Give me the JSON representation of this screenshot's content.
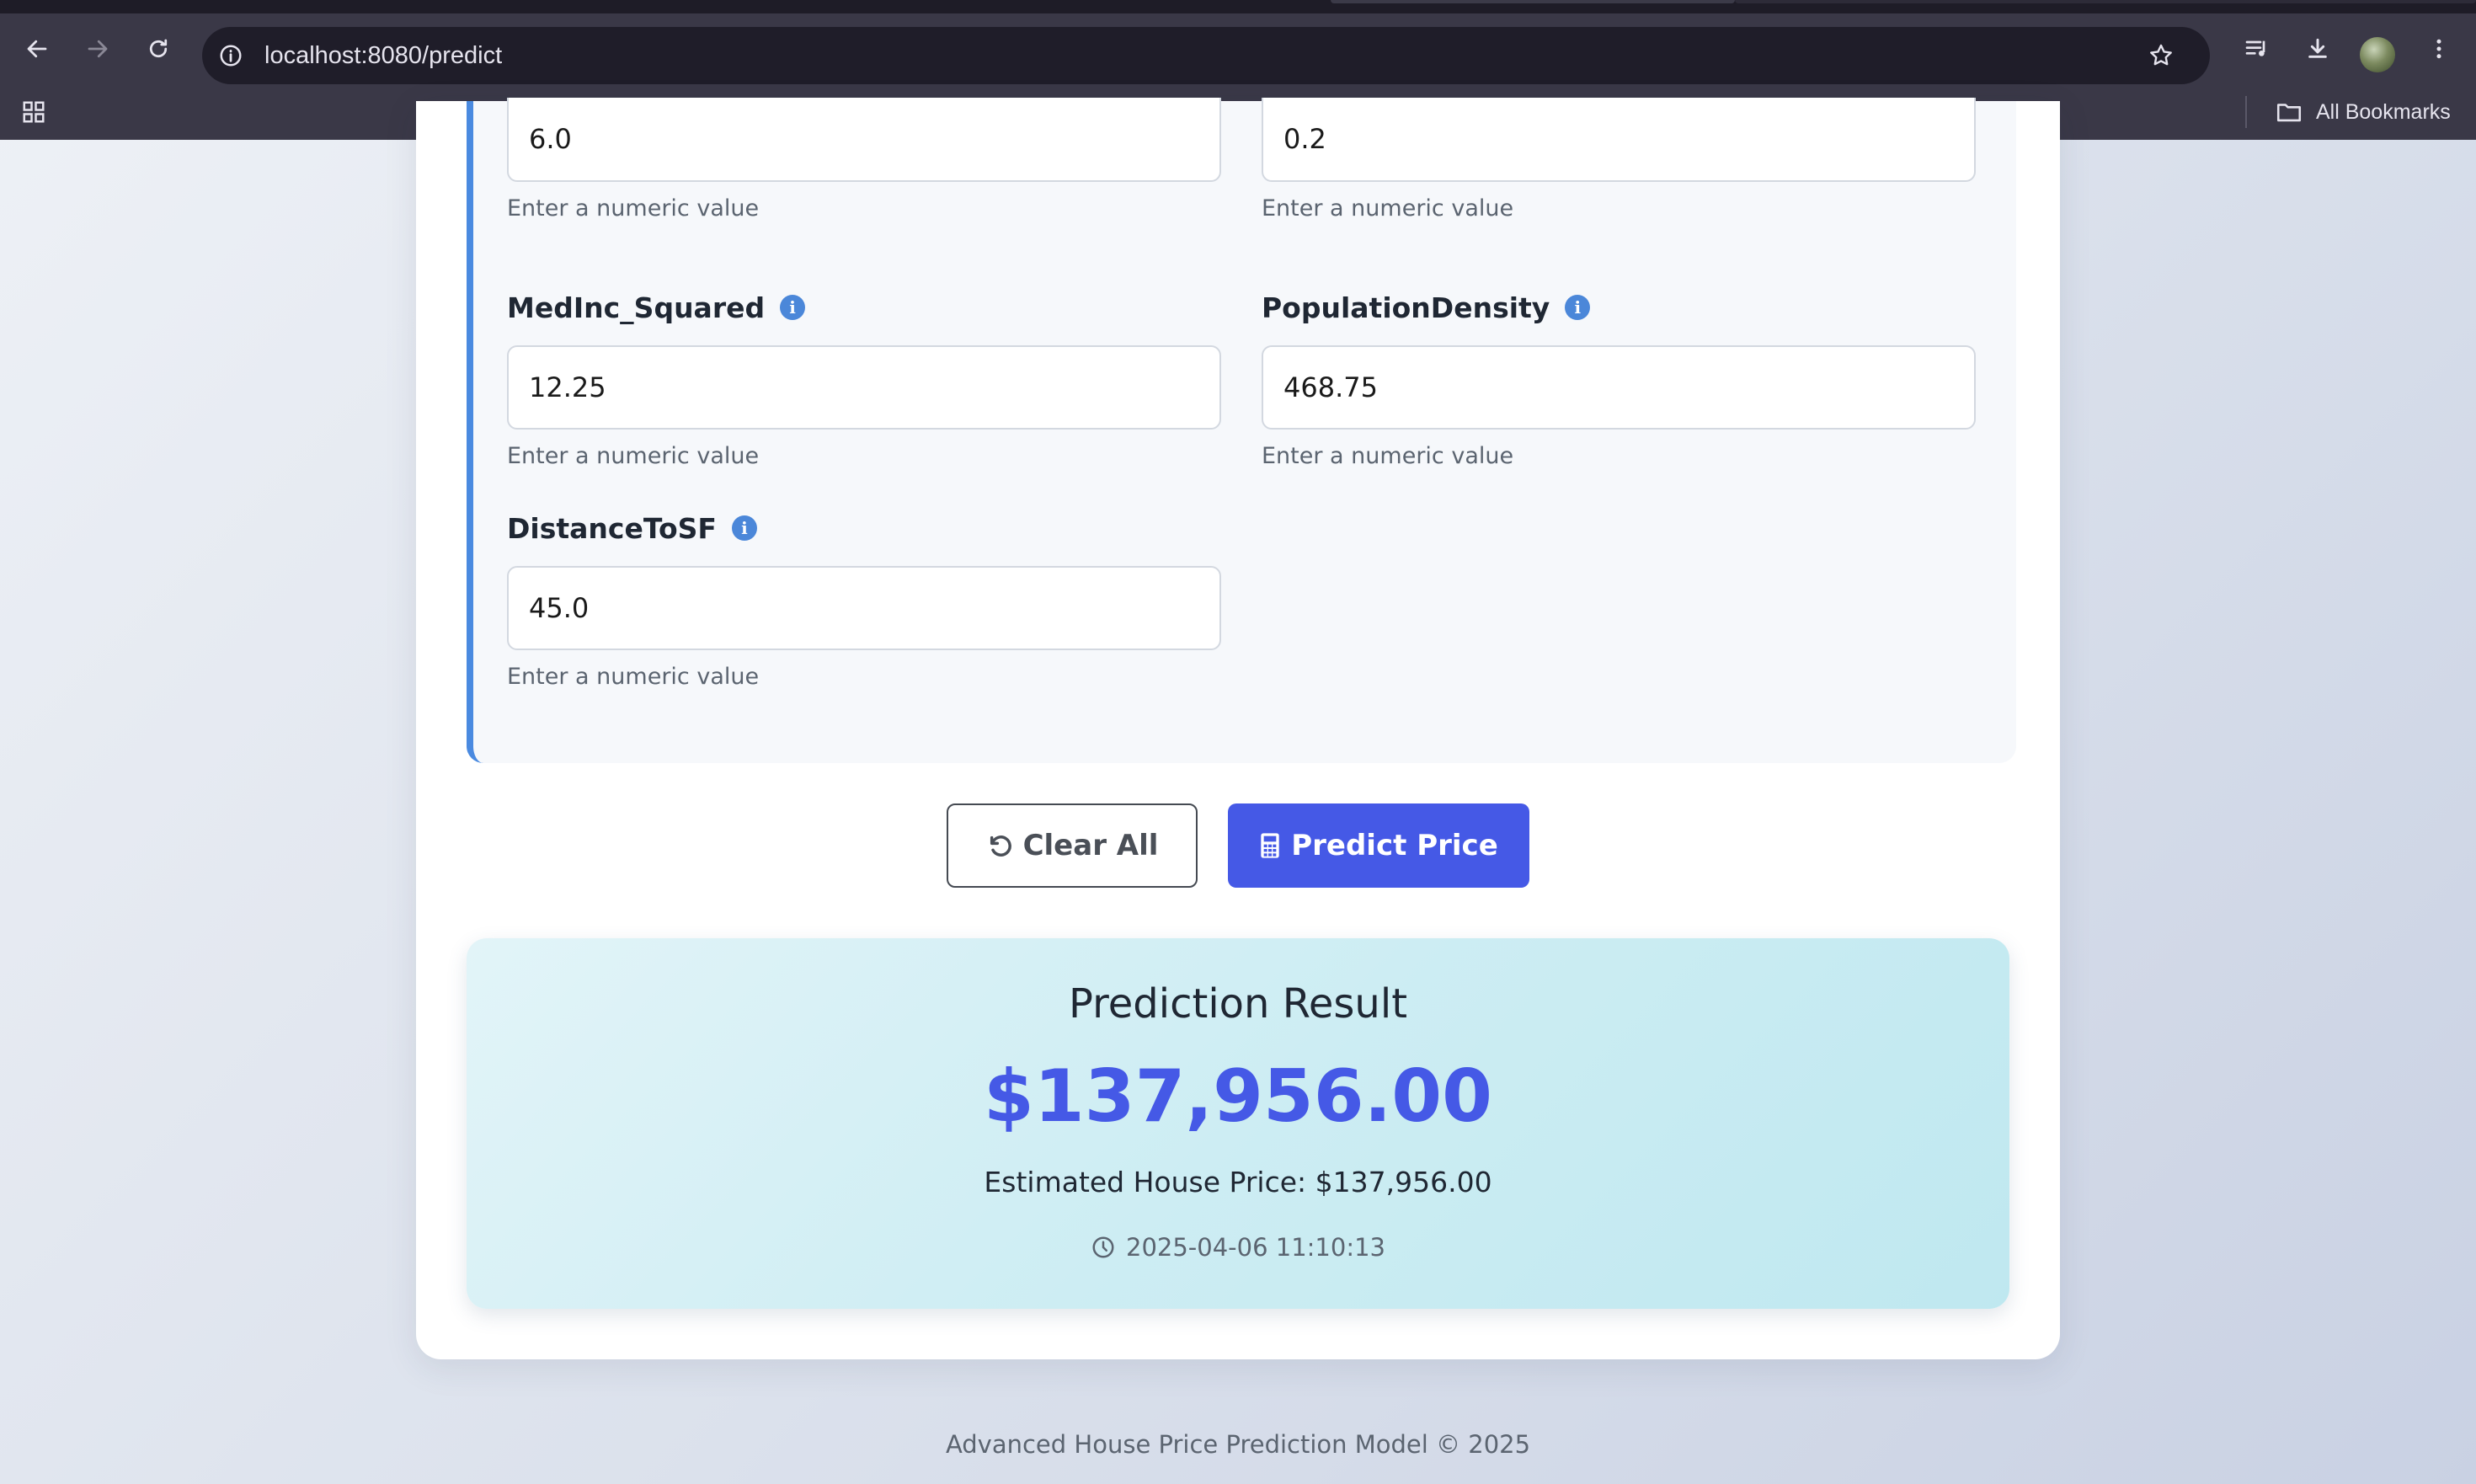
{
  "browser": {
    "url": "localhost:8080/predict",
    "bookmarks_label": "All Bookmarks",
    "icons": [
      "back-icon",
      "forward-icon",
      "reload-icon",
      "site-info-icon",
      "star-icon",
      "media-icon",
      "download-icon",
      "avatar",
      "more-icon",
      "apps-icon",
      "folder-icon"
    ]
  },
  "fields": [
    {
      "label": "",
      "value": "6.0",
      "hint": "Enter a numeric value"
    },
    {
      "label": "",
      "value": "0.2",
      "hint": "Enter a numeric value"
    },
    {
      "label": "MedInc_Squared",
      "value": "12.25",
      "hint": "Enter a numeric value"
    },
    {
      "label": "PopulationDensity",
      "value": "468.75",
      "hint": "Enter a numeric value"
    },
    {
      "label": "DistanceToSF",
      "value": "45.0",
      "hint": "Enter a numeric value"
    }
  ],
  "buttons": {
    "clear_label": "Clear All",
    "predict_label": "Predict Price"
  },
  "result": {
    "title": "Prediction Result",
    "price": "$137,956.00",
    "estimate": "Estimated House Price: $137,956.00",
    "timestamp": "2025-04-06 11:10:13"
  },
  "footer": "Advanced House Price Prediction Model © 2025",
  "colors": {
    "accent": "#4559e6",
    "info": "#4b87d9",
    "section_border": "#4a8ae0"
  }
}
